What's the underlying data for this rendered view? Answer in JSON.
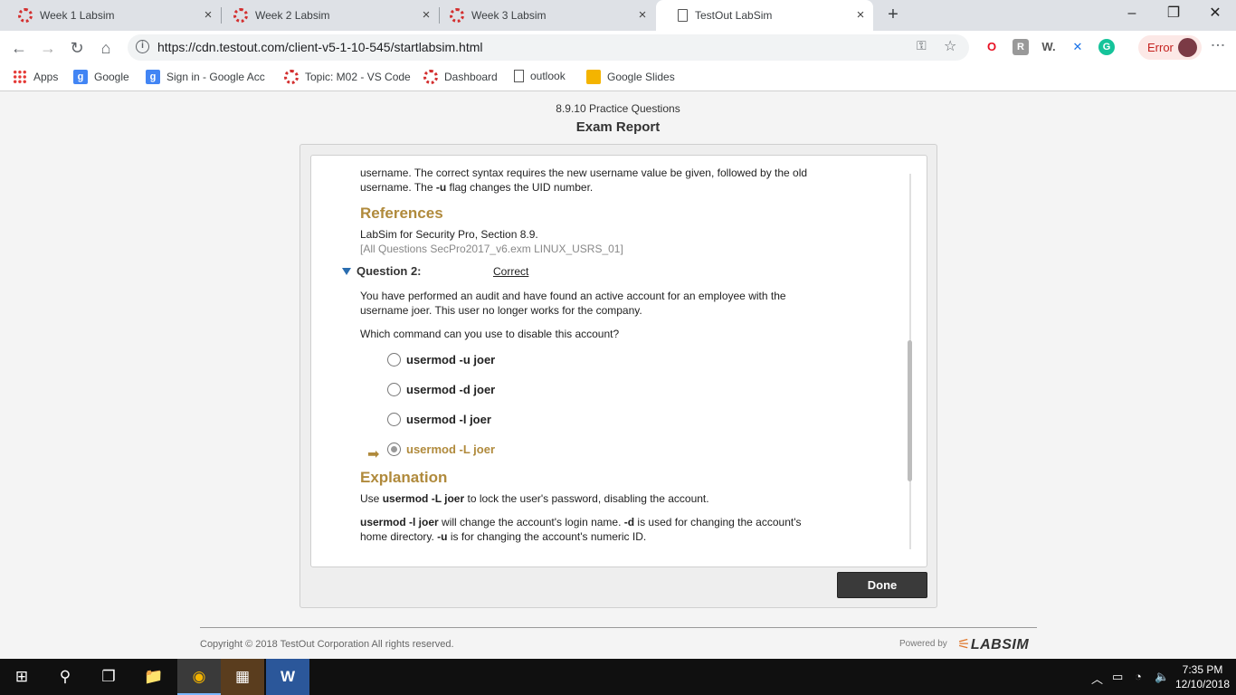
{
  "tabs": [
    {
      "title": "Week 1 Labsim",
      "close": "×"
    },
    {
      "title": "Week 2 Labsim",
      "close": "×"
    },
    {
      "title": "Week 3 Labsim",
      "close": "×"
    },
    {
      "title": "TestOut LabSim",
      "close": "×"
    }
  ],
  "new_tab": "+",
  "window": {
    "minimize": "–",
    "restore": "❐",
    "close": "✕"
  },
  "nav": {
    "back": "←",
    "forward": "→",
    "reload": "↻",
    "home": "⌂"
  },
  "omnibox": {
    "info": "i",
    "url": "https://cdn.testout.com/client-v5-1-10-545/startlabsim.html",
    "key": "⚿",
    "star": "☆"
  },
  "extensions": {
    "opera": "O",
    "ext2": "R",
    "ext3": "W.",
    "ext4": "✕",
    "grammarly": "G"
  },
  "error_chip": "Error",
  "menu": "⋮",
  "bookmarks": [
    {
      "label": "Apps",
      "icon": "apps-icon"
    },
    {
      "label": "Google",
      "icon": "google-icon"
    },
    {
      "label": "Sign in - Google Acc",
      "icon": "google-icon"
    },
    {
      "label": "Topic: M02 - VS Code",
      "icon": "ring-icon"
    },
    {
      "label": "Dashboard",
      "icon": "ring-icon"
    },
    {
      "label": "outlook",
      "icon": "document-icon"
    },
    {
      "label": "Google Slides",
      "icon": "slides-icon"
    }
  ],
  "page": {
    "subtitle": "8.9.10 Practice Questions",
    "title": "Exam Report",
    "prev_explanation_line1": "username. The correct syntax requires the new username value be given, followed by the old",
    "prev_explanation_line2_a": "username. The ",
    "prev_explanation_line2_b": "-u",
    "prev_explanation_line2_c": " flag changes the UID number.",
    "references_heading": "References",
    "reference_text": "LabSim for Security Pro, Section 8.9.",
    "reference_id": "[All Questions SecPro2017_v6.exm LINUX_USRS_01]",
    "question_label": "Question 2:",
    "question_status": "Correct",
    "question_line1": "You have performed an audit and have found an active account for an employee with the",
    "question_line2": "username joer. This user no longer works for the company.",
    "prompt": "Which command can you use to disable this account?",
    "options": [
      "usermod -u joer",
      "usermod -d joer",
      "usermod -l joer",
      "usermod -L joer"
    ],
    "selected_arrow": "➡",
    "explanation_heading": "Explanation",
    "expl1_a": "Use ",
    "expl1_b": "usermod -L joer",
    "expl1_c": " to lock the user's password, disabling the account.",
    "expl2_a": "usermod -l joer",
    "expl2_b": " will change the account's login name. ",
    "expl2_c": "-d",
    "expl2_d": " is used for changing the account's",
    "expl3_a": "home directory. ",
    "expl3_b": "-u",
    "expl3_c": " is for changing the account's numeric ID.",
    "done_button": "Done",
    "copyright": "Copyright © 2018  TestOut Corporation All rights reserved.",
    "powered_by": "Powered by",
    "logo_mark": "⚟",
    "logo_text": "LABSIM"
  },
  "taskbar": {
    "start": "⊞",
    "search": "⚲",
    "taskview": "❐",
    "explorer": "📁",
    "chrome": "◉",
    "app3": "▦",
    "word": "W",
    "tray_up": "︿",
    "battery": "▭",
    "wifi": "◔",
    "volume": "🔈",
    "time": "7:35 PM",
    "date": "12/10/2018"
  }
}
